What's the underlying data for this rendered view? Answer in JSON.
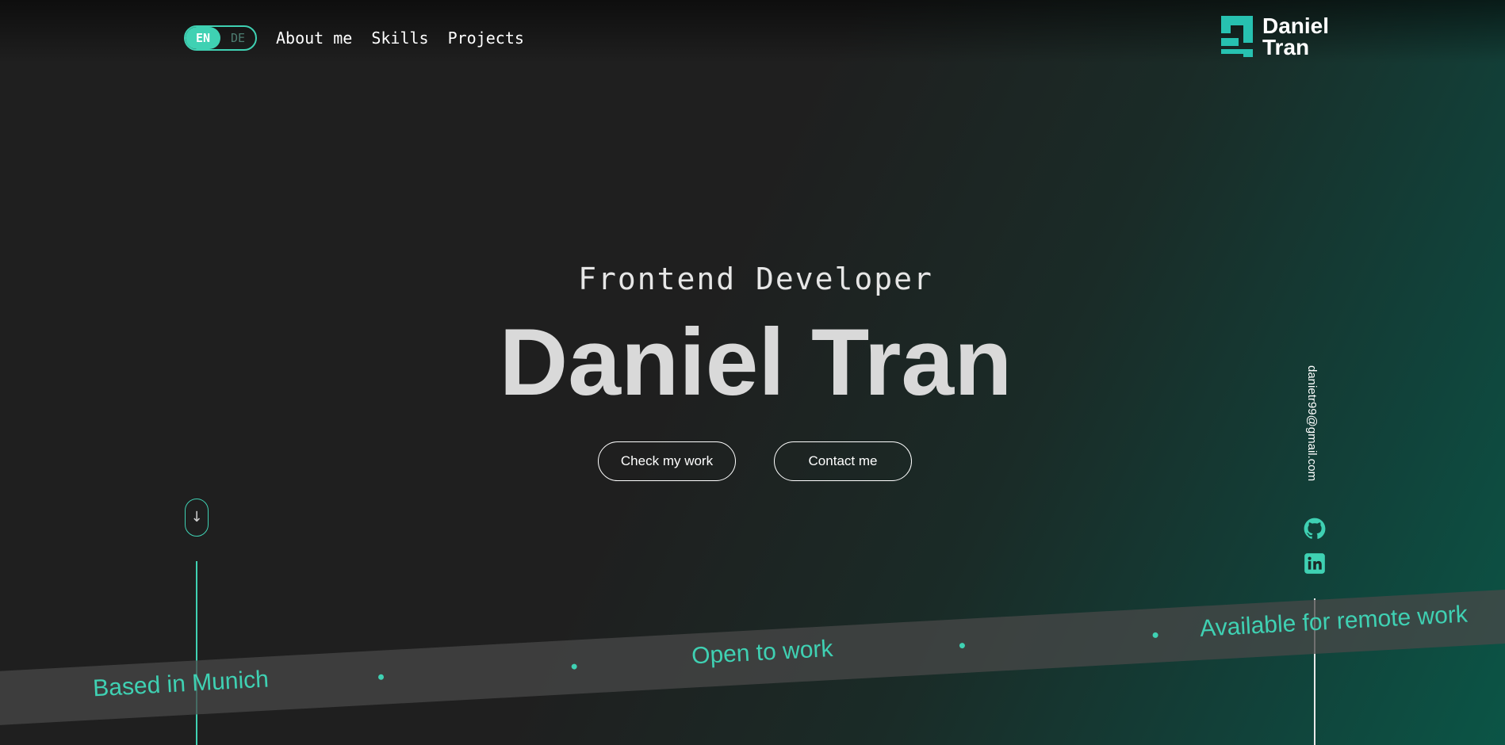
{
  "header": {
    "lang": {
      "active": "EN",
      "inactive": "DE"
    },
    "nav": [
      "About me",
      "Skills",
      "Projects"
    ],
    "logo": {
      "first": "Daniel",
      "last": "Tran"
    }
  },
  "hero": {
    "role": "Frontend Developer",
    "name": "Daniel Tran",
    "buttons": {
      "work": "Check my work",
      "contact": "Contact me"
    }
  },
  "scroll": {
    "arrow": "↓"
  },
  "social": {
    "email": "danietr99@gmail.com",
    "icons": [
      "github-icon",
      "linkedin-icon"
    ]
  },
  "ribbon": {
    "items": [
      "Based in Munich",
      "Open to work",
      "Available for remote work"
    ]
  },
  "colors": {
    "accent": "#3fd1b3",
    "background": "#1f1f1f",
    "gradient_end": "#0b5546"
  }
}
